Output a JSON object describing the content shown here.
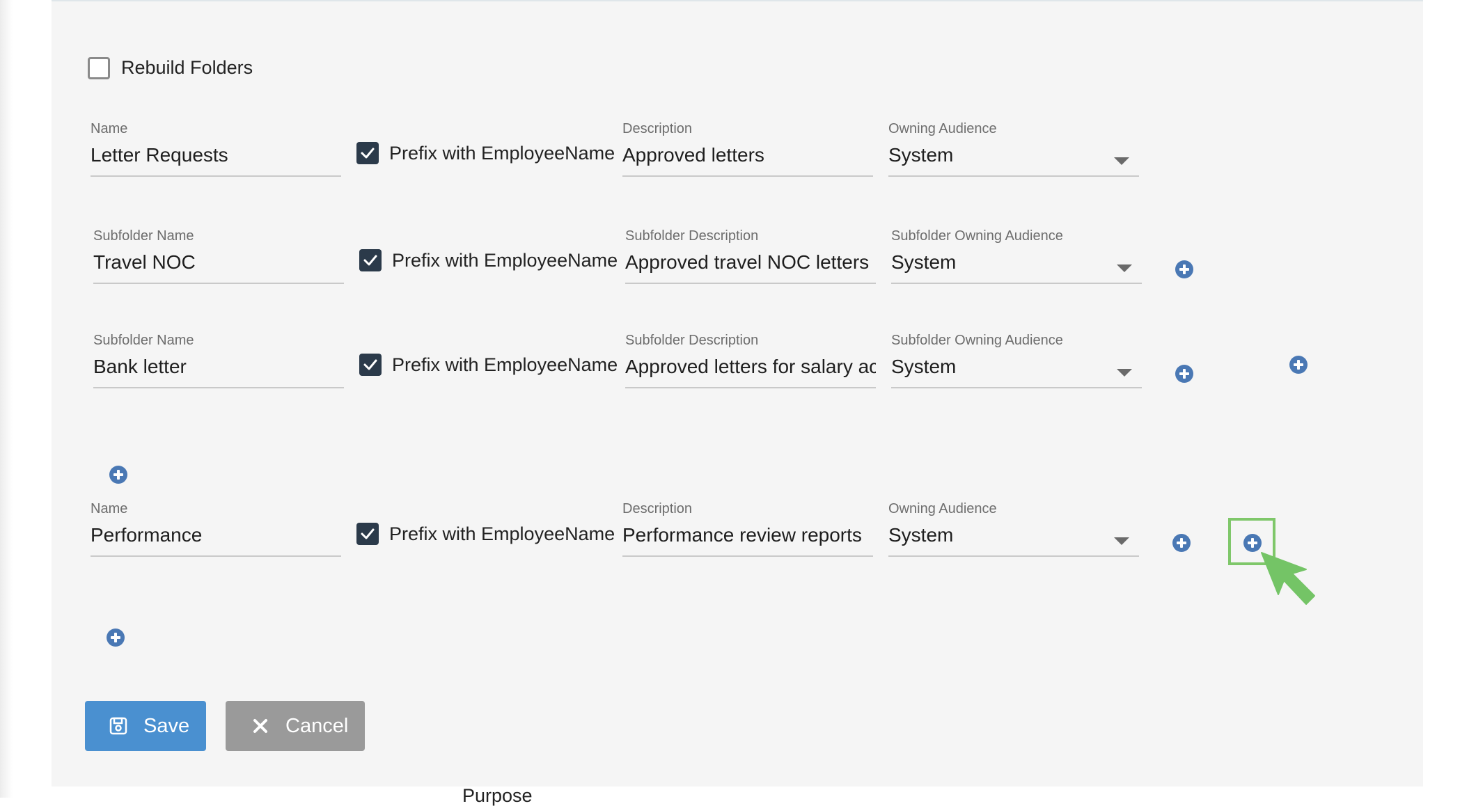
{
  "rebuild_folders": {
    "label": "Rebuild Folders",
    "checked": false
  },
  "folder_1": {
    "name_label": "Name",
    "name_value": "Letter Requests",
    "prefix_label": "Prefix with EmployeeName",
    "prefix_checked": true,
    "description_label": "Description",
    "description_value": "Approved letters",
    "audience_label": "Owning Audience",
    "audience_value": "System"
  },
  "subfolder_1": {
    "name_label": "Subfolder Name",
    "name_value": "Travel NOC",
    "prefix_label": "Prefix with EmployeeName",
    "prefix_checked": true,
    "description_label": "Subfolder Description",
    "description_value": "Approved travel NOC letters",
    "audience_label": "Subfolder Owning Audience",
    "audience_value": "System"
  },
  "subfolder_2": {
    "name_label": "Subfolder Name",
    "name_value": "Bank letter",
    "prefix_label": "Prefix with EmployeeName",
    "prefix_checked": true,
    "description_label": "Subfolder Description",
    "description_value": "Approved letters for salary acc",
    "audience_label": "Subfolder Owning Audience",
    "audience_value": "System"
  },
  "folder_2": {
    "name_label": "Name",
    "name_value": "Performance",
    "prefix_label": "Prefix with EmployeeName",
    "prefix_checked": true,
    "description_label": "Description",
    "description_value": "Performance review reports",
    "audience_label": "Owning Audience",
    "audience_value": "System"
  },
  "actions": {
    "save_label": "Save",
    "cancel_label": "Cancel"
  },
  "footer": {
    "partial_label": "Purpose"
  },
  "colors": {
    "primary": "#4a90d0",
    "cancel": "#9a9a9a",
    "plus_icon": "#4a78b4",
    "checkbox": "#2b3a4a",
    "highlight": "#7fc76a"
  }
}
